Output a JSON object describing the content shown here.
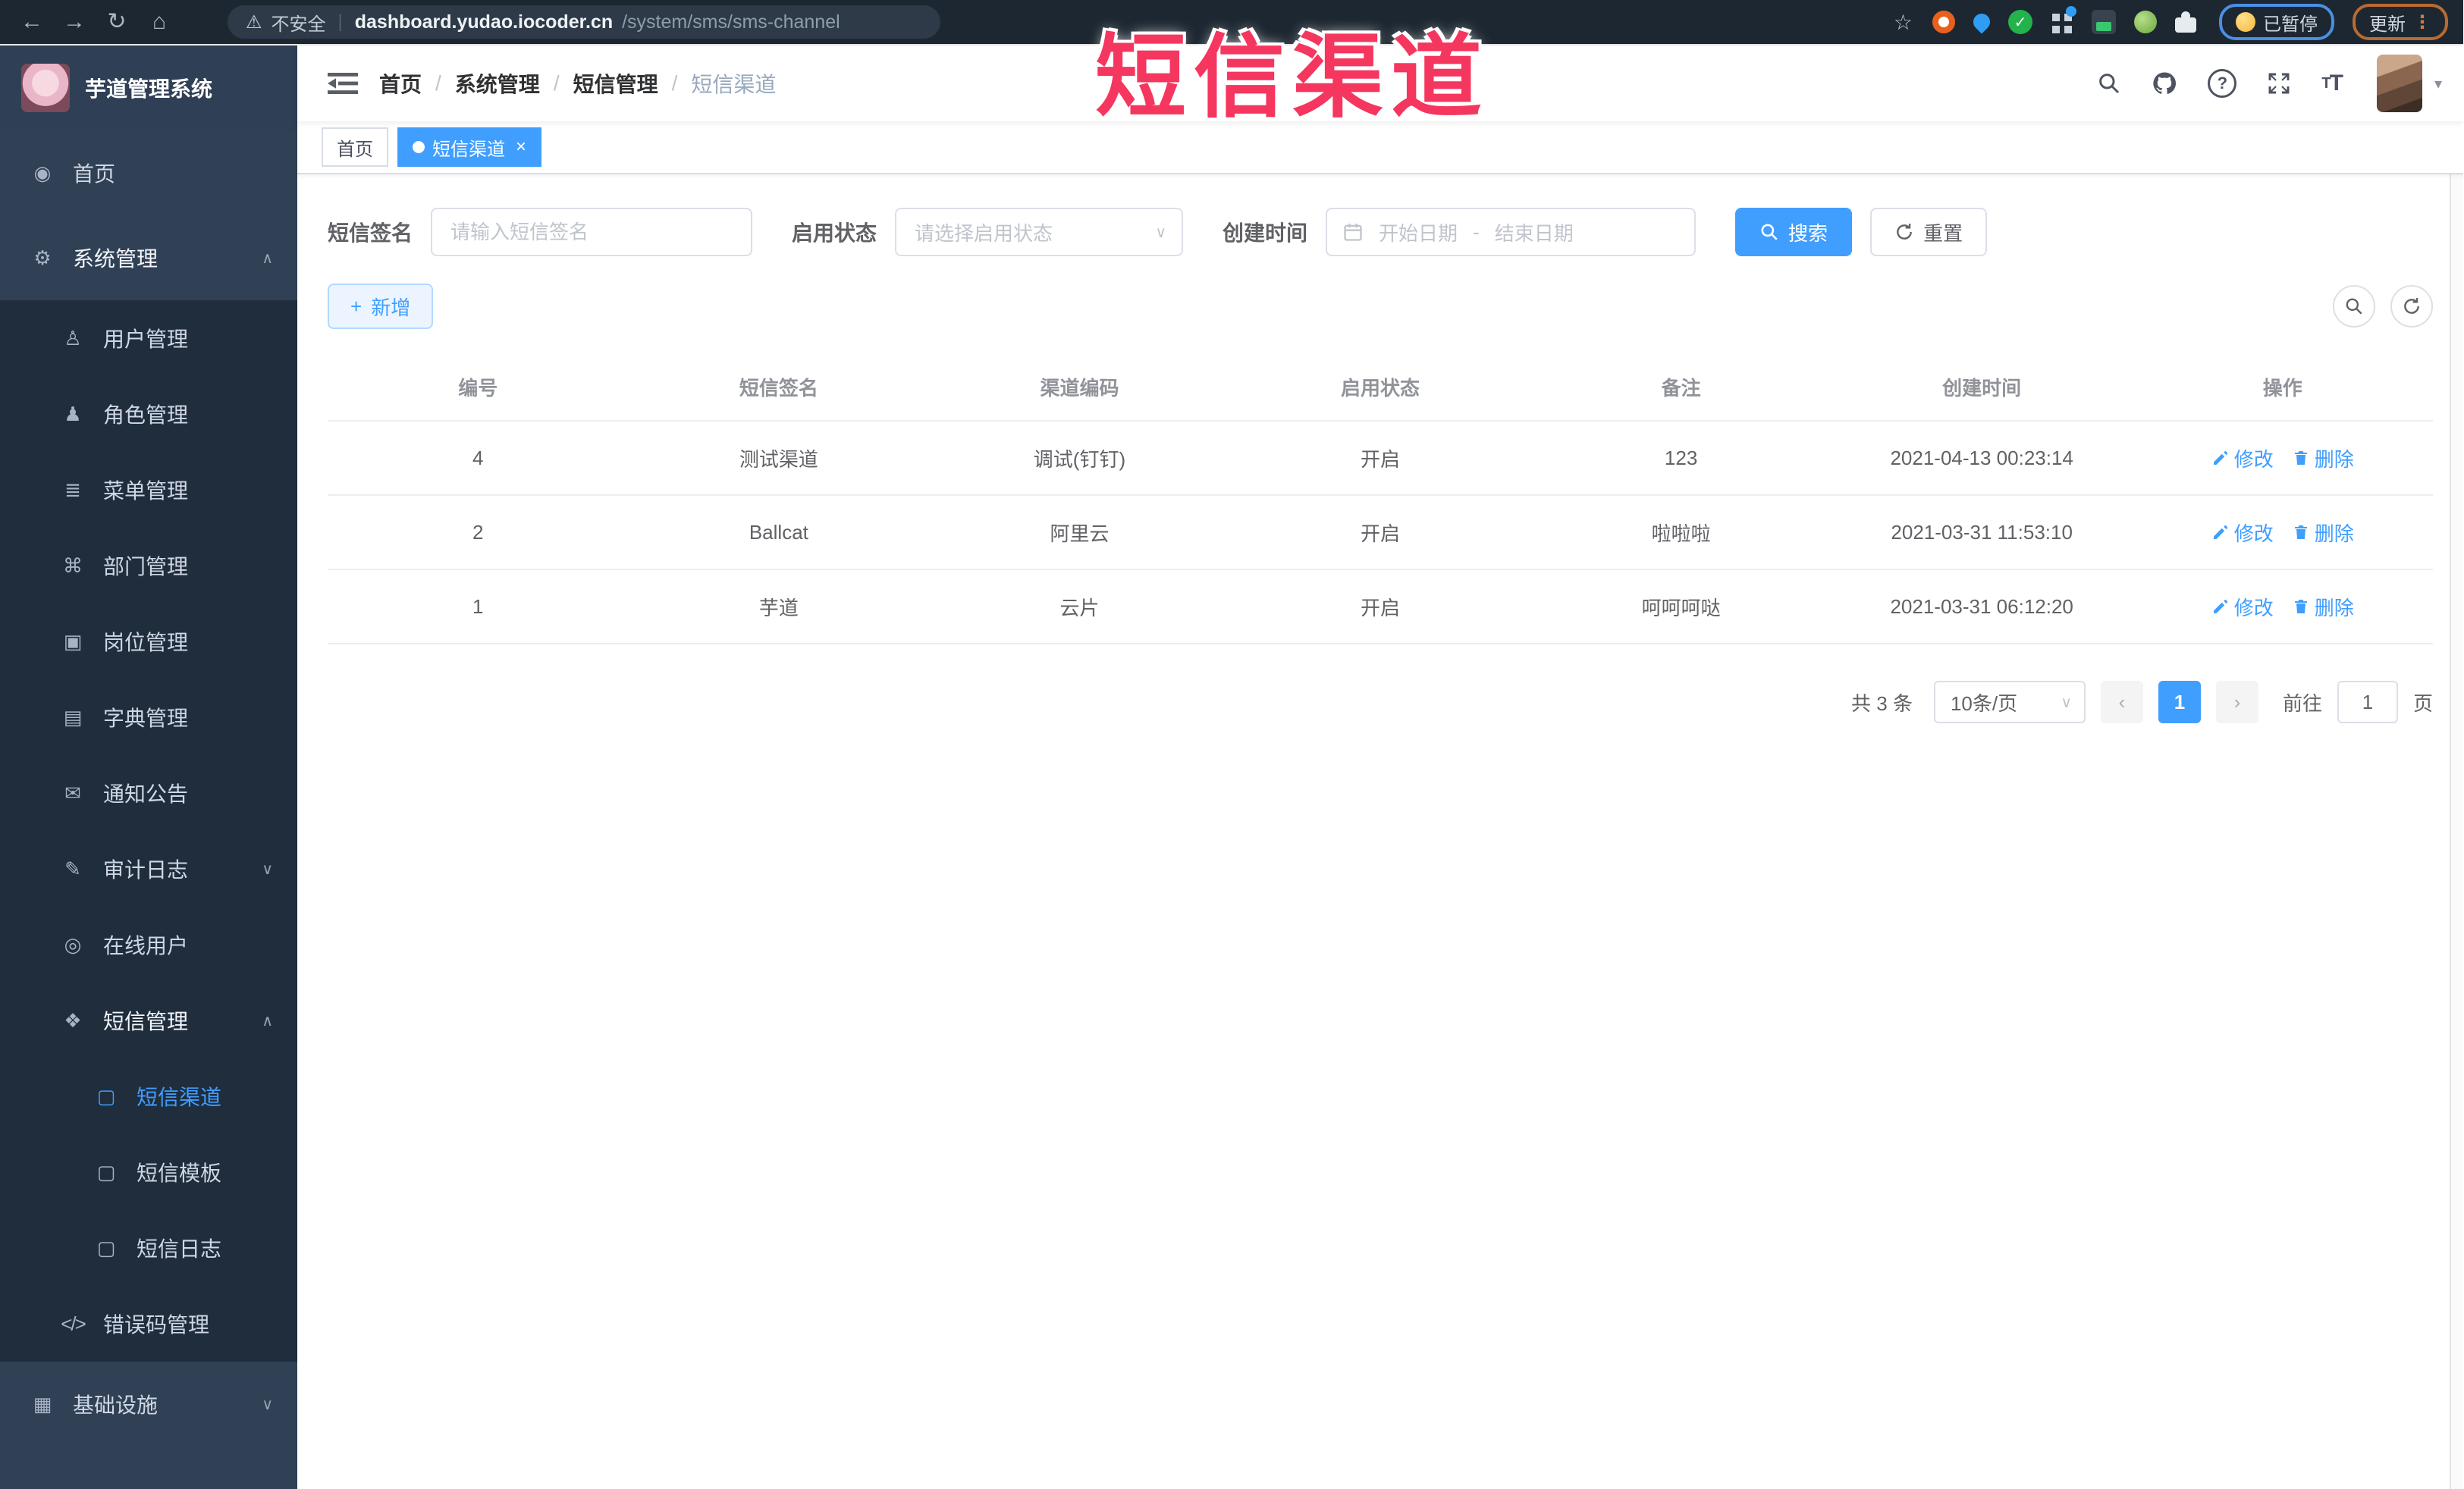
{
  "annotation": {
    "text": "短信渠道"
  },
  "browser": {
    "security_label": "不安全",
    "url_host": "dashboard.yudao.iocoder.cn",
    "url_path": "/system/sms/sms-channel",
    "paused_label": "已暂停",
    "update_label": "更新"
  },
  "icons": {
    "back": "←",
    "forward": "→",
    "reload": "↻",
    "home": "⌂",
    "warning": "⚠",
    "star": "☆",
    "check": "✓",
    "kebab": "⋮",
    "caret_down": "▾",
    "caret_up": "▴",
    "chevron_down": "∨",
    "chevron_up": "∧",
    "prev": "‹",
    "next": "›",
    "close": "×",
    "divider": "|",
    "question": "?",
    "fontsize_small": "T",
    "fontsize_big": "T",
    "plus": "+"
  },
  "sidebar": {
    "app_title": "芋道管理系统",
    "menu": [
      {
        "label": "首页",
        "icon": "◉"
      },
      {
        "label": "系统管理",
        "icon": "⚙"
      },
      {
        "label": "用户管理",
        "icon": "♙"
      },
      {
        "label": "角色管理",
        "icon": "♟"
      },
      {
        "label": "菜单管理",
        "icon": "≣"
      },
      {
        "label": "部门管理",
        "icon": "⌘"
      },
      {
        "label": "岗位管理",
        "icon": "▣"
      },
      {
        "label": "字典管理",
        "icon": "▤"
      },
      {
        "label": "通知公告",
        "icon": "✉"
      },
      {
        "label": "审计日志",
        "icon": "✎"
      },
      {
        "label": "在线用户",
        "icon": "◎"
      },
      {
        "label": "短信管理",
        "icon": "❖"
      },
      {
        "label": "短信渠道",
        "icon": "▢"
      },
      {
        "label": "短信模板",
        "icon": "▢"
      },
      {
        "label": "短信日志",
        "icon": "▢"
      },
      {
        "label": "错误码管理",
        "icon": "</>"
      },
      {
        "label": "基础设施",
        "icon": "▦"
      }
    ]
  },
  "navbar": {
    "breadcrumb": [
      "首页",
      "系统管理",
      "短信管理",
      "短信渠道"
    ],
    "separator": "/"
  },
  "tags": [
    {
      "label": "首页"
    },
    {
      "label": "短信渠道"
    }
  ],
  "filters": {
    "signature_label": "短信签名",
    "signature_placeholder": "请输入短信签名",
    "status_label": "启用状态",
    "status_placeholder": "请选择启用状态",
    "time_label": "创建时间",
    "start_placeholder": "开始日期",
    "range_separator": "-",
    "end_placeholder": "结束日期",
    "search_label": "搜索",
    "reset_label": "重置"
  },
  "toolbar": {
    "add_label": "新增"
  },
  "table": {
    "headers": [
      "编号",
      "短信签名",
      "渠道编码",
      "启用状态",
      "备注",
      "创建时间",
      "操作"
    ],
    "edit_label": "修改",
    "delete_label": "删除",
    "rows": [
      {
        "id": "4",
        "signature": "测试渠道",
        "code": "调试(钉钉)",
        "status": "开启",
        "remark": "123",
        "created": "2021-04-13 00:23:14"
      },
      {
        "id": "2",
        "signature": "Ballcat",
        "code": "阿里云",
        "status": "开启",
        "remark": "啦啦啦",
        "created": "2021-03-31 11:53:10"
      },
      {
        "id": "1",
        "signature": "芋道",
        "code": "云片",
        "status": "开启",
        "remark": "呵呵呵哒",
        "created": "2021-03-31 06:12:20"
      }
    ]
  },
  "pagination": {
    "total_label": "共 3 条",
    "page_size_label": "10条/页",
    "current_page": "1",
    "goto_label": "前往",
    "goto_value": "1",
    "page_unit_label": "页"
  },
  "colors": {
    "primary": "#409eff",
    "annotation_red": "#f5365f",
    "sidebar_bg": "#304156",
    "submenu_bg": "#1f2d3d",
    "browser_bar_bg": "#1d2731"
  }
}
